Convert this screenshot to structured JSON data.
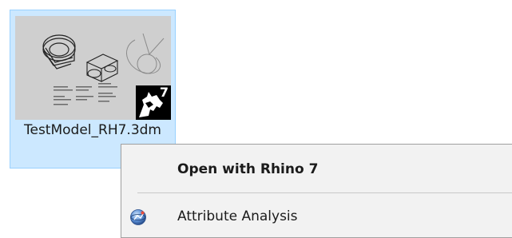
{
  "file": {
    "name": "TestModel_RH7.3dm",
    "badge_version": "7"
  },
  "context_menu": {
    "items": [
      {
        "label": "Open with Rhino 7",
        "default": true,
        "icon": "none"
      },
      {
        "label": "Attribute Analysis",
        "default": false,
        "icon": "attribute-analysis-icon"
      }
    ]
  },
  "colors": {
    "selection_fill": "#cce8ff",
    "selection_border": "#99d1ff",
    "menu_background": "#f2f2f2"
  }
}
